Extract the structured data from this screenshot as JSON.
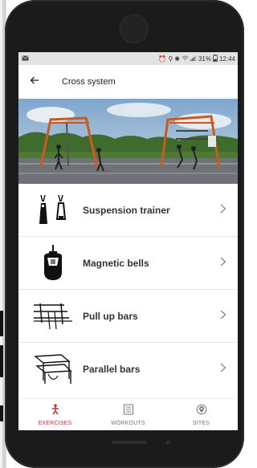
{
  "status_bar": {
    "icons": [
      "mail-icon",
      "alarm-icon",
      "location-icon",
      "bluetooth-icon",
      "wifi-icon",
      "signal-icon",
      "battery-icon"
    ],
    "battery": "31%",
    "time": "12:44"
  },
  "header": {
    "back_icon": "back-arrow-icon",
    "title": "Cross system"
  },
  "hero": {
    "alt": ""
  },
  "items": [
    {
      "label": "Suspension trainer",
      "icon": "suspension-trainer-icon"
    },
    {
      "label": "Magnetic bells",
      "icon": "magnetic-bells-icon"
    },
    {
      "label": "Pull up bars",
      "icon": "pull-up-bars-icon"
    },
    {
      "label": "Parallel bars",
      "icon": "parallel-bars-icon"
    }
  ],
  "bottom_nav": [
    {
      "label": "EXERCISES",
      "active": true,
      "icon": "exercise-icon"
    },
    {
      "label": "WORKOUTS",
      "active": false,
      "icon": "workouts-icon"
    },
    {
      "label": "SITES",
      "active": false,
      "icon": "sites-icon"
    }
  ],
  "colors": {
    "accent": "#c42f3a",
    "status_bar": "#e3e3e3"
  }
}
